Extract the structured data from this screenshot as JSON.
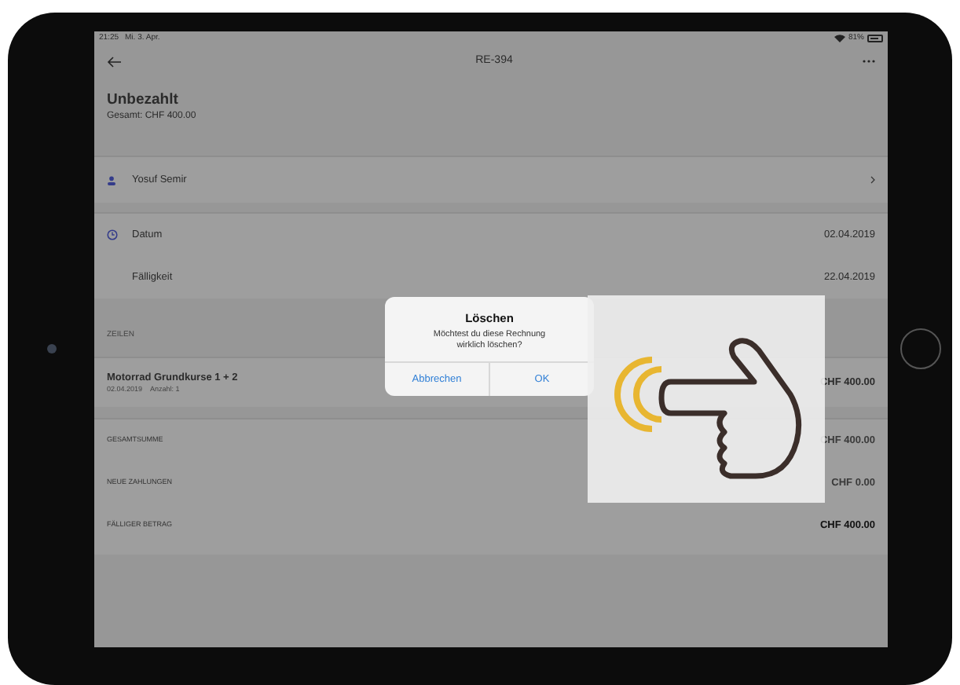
{
  "status_bar": {
    "time": "21:25",
    "date": "Mi. 3. Apr.",
    "battery": "81%"
  },
  "nav": {
    "title": "RE-394"
  },
  "header": {
    "status": "Unbezahlt",
    "total": "Gesamt: CHF 400.00"
  },
  "customer": {
    "name": "Yosuf Semir"
  },
  "dates": [
    {
      "kind": "icon",
      "label": "Datum",
      "value": "02.04.2019"
    },
    {
      "kind": "plain",
      "label": "Fälligkeit",
      "value": "22.04.2019"
    }
  ],
  "lines_section": {
    "heading": "ZEILEN",
    "items": [
      {
        "title": "Motorrad Grundkurse 1 + 2",
        "date": "02.04.2019",
        "quantity": "Anzahl: 1",
        "amount": "CHF 400.00"
      }
    ]
  },
  "totals": [
    {
      "label": "GESAMTSUMME",
      "value": "CHF 400.00",
      "emphasis": false
    },
    {
      "label": "NEUE ZAHLUNGEN",
      "value": "CHF 0.00",
      "emphasis": false
    },
    {
      "label": "FÄLLIGER BETRAG",
      "value": "CHF 400.00",
      "emphasis": true
    }
  ],
  "dialog": {
    "title": "Löschen",
    "message": "Möchtest du diese Rechnung wirklich löschen?",
    "buttons": [
      {
        "label": "Abbrechen"
      },
      {
        "label": "OK"
      }
    ]
  }
}
